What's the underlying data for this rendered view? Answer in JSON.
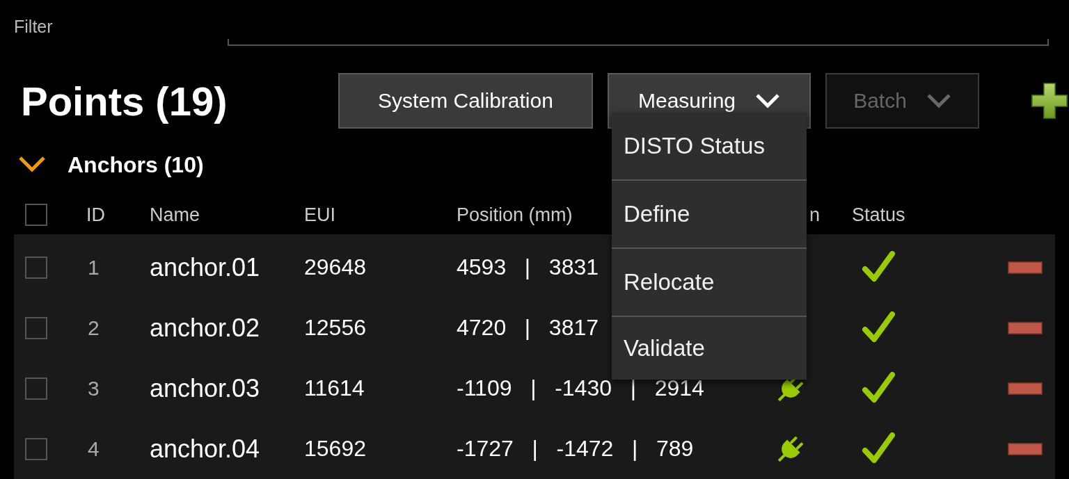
{
  "filter": {
    "label": "Filter"
  },
  "title": "Points (19)",
  "toolbar": [
    {
      "label": "System Calibration",
      "kind": "button",
      "disabled": false
    },
    {
      "label": "Measuring",
      "kind": "dropdown",
      "disabled": false,
      "expanded": true,
      "menu": [
        "DISTO Status",
        "Define",
        "Relocate",
        "Validate"
      ]
    },
    {
      "label": "Batch",
      "kind": "dropdown",
      "disabled": true,
      "expanded": false
    }
  ],
  "group": {
    "label": "Anchors (10)",
    "expanded": true,
    "select_all": false,
    "columns": [
      "ID",
      "Name",
      "EUI",
      "Position (mm)",
      "n",
      "Status"
    ],
    "rows": [
      {
        "checked": false,
        "id": "1",
        "name": "anchor.01",
        "eui": "29648",
        "position": "4593   |   3831",
        "ok": true
      },
      {
        "checked": false,
        "id": "2",
        "name": "anchor.02",
        "eui": "12556",
        "position": "4720   |   3817",
        "ok": true
      },
      {
        "checked": false,
        "id": "3",
        "name": "anchor.03",
        "eui": "11614",
        "position": "-1109   |   -1430   |   2914",
        "plugged": true,
        "ok": true
      },
      {
        "checked": false,
        "id": "4",
        "name": "anchor.04",
        "eui": "15692",
        "position": "-1727   |   -1472   |   789",
        "plugged": true,
        "ok": true
      }
    ]
  }
}
